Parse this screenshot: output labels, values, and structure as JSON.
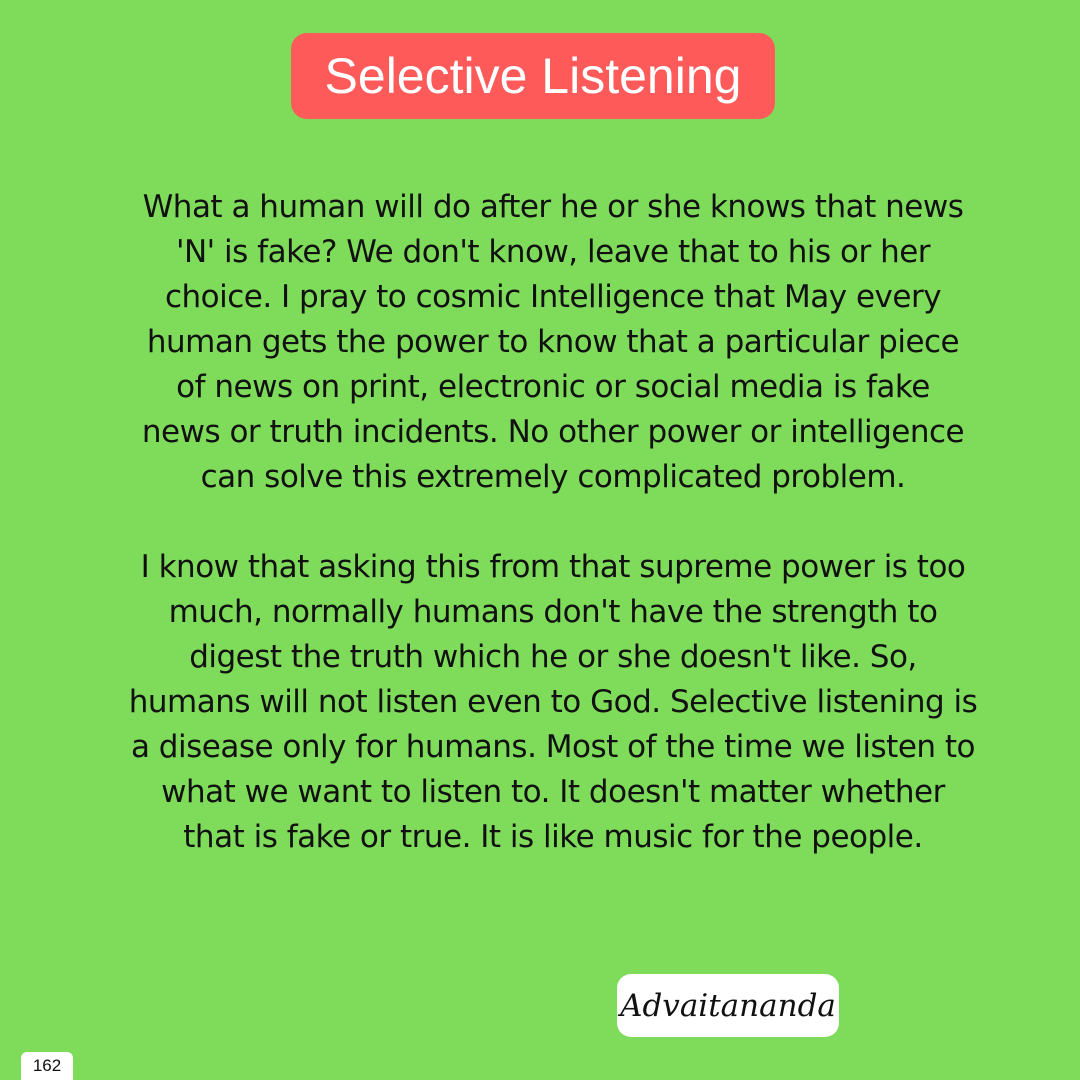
{
  "title": "Selective Listening",
  "paragraph_1": [
    "What a human will do after he or she knows that news",
    "'N' is fake? We don't know, leave that to his or her",
    "choice. I pray to cosmic Intelligence that May every",
    "human gets the power to know that a particular piece",
    "of news on print, electronic or social media is fake",
    "news or truth incidents. No other power or intelligence",
    "can solve this extremely complicated problem."
  ],
  "paragraph_2": [
    "I know that asking this from that supreme power is too",
    "much, normally humans don't have the strength to",
    "digest the truth which he or she doesn't like. So,",
    "humans will not listen even to God. Selective listening is",
    "a disease only for humans. Most of the time we listen to",
    "what we want to listen to. It doesn't matter whether",
    "that is fake or true. It is like music for the people."
  ],
  "signature": "Advaitananda",
  "page_number": "162",
  "colors": {
    "background": "#7fdb5a",
    "title_badge": "#ff5a5a",
    "title_text": "#ffffff",
    "body_text": "#111111",
    "signature_box": "#ffffff"
  }
}
